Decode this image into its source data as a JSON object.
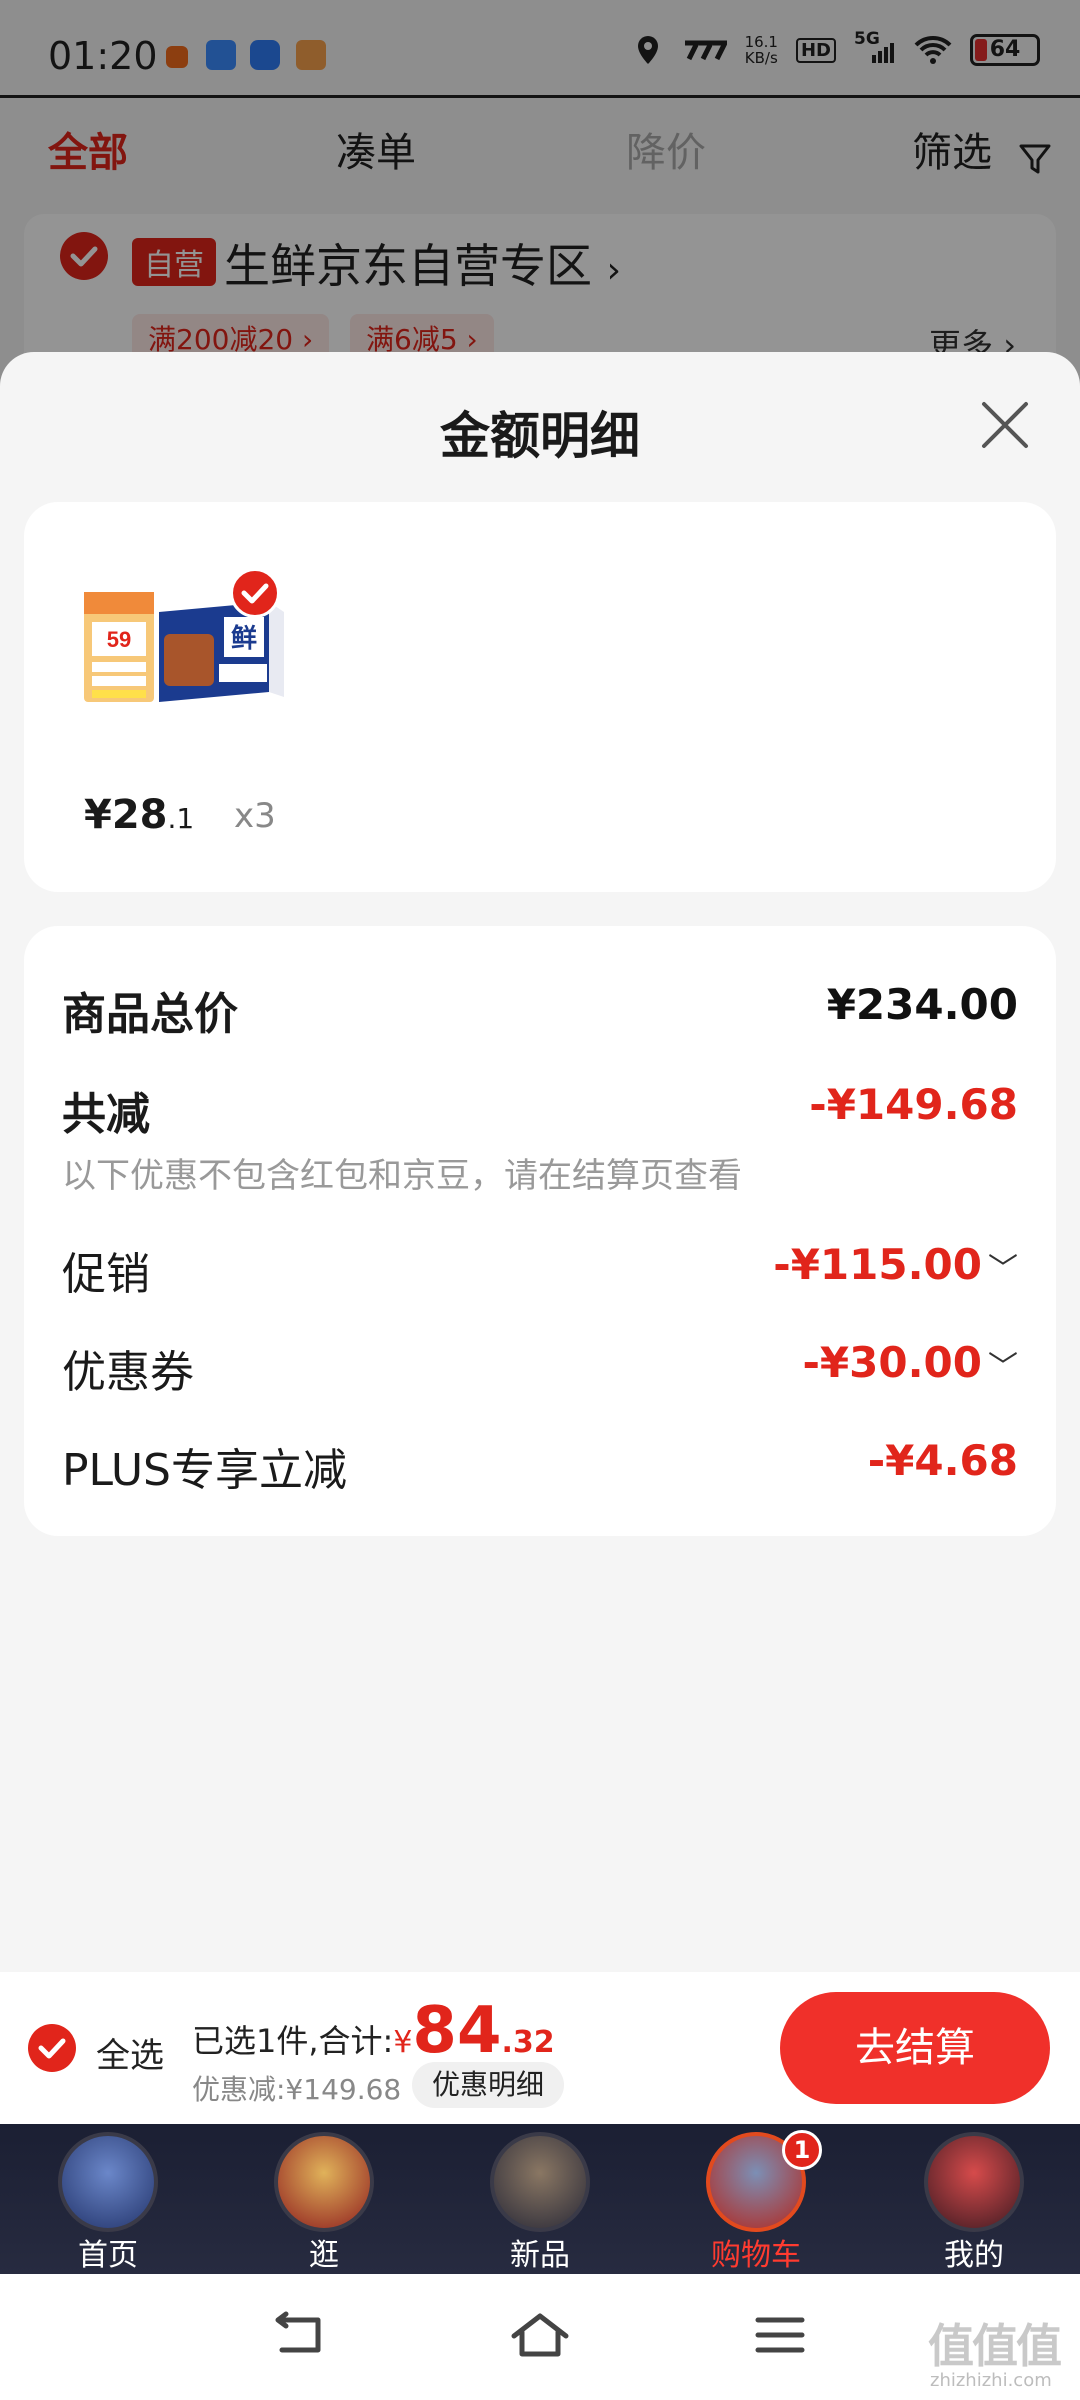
{
  "status": {
    "time": "01:20",
    "speed": "16.1",
    "speed_unit": "KB/s",
    "net": "5G",
    "hd": "HD",
    "battery": "64"
  },
  "top_tabs": [
    "全部",
    "凑单",
    "降价",
    "筛选"
  ],
  "shop": {
    "tag": "自营",
    "name": "生鲜京东自营专区",
    "promos": [
      "满200减20",
      "满6减5"
    ],
    "more": "更多"
  },
  "sheet": {
    "title": "金额明细",
    "item": {
      "price_yen": "¥",
      "price_int": "28",
      "price_dec": ".1",
      "qty": "x3"
    },
    "total_label": "商品总价",
    "total_value": "¥234.00",
    "discount_label": "共减",
    "discount_value": "-¥149.68",
    "discount_note": "以下优惠不包含红包和京豆，请在结算页查看",
    "rows": [
      {
        "label": "促销",
        "value": "-¥115.00"
      },
      {
        "label": "优惠券",
        "value": "-¥30.00"
      },
      {
        "label": "PLUS专享立减",
        "value": "-¥4.68"
      }
    ]
  },
  "checkout": {
    "select_all": "全选",
    "summary_prefix": "已选1件,合计:",
    "amount_yen": "¥",
    "amount_int": "84",
    "amount_dec": ".32",
    "discount_text": "优惠减:¥149.68",
    "detail_button": "优惠明细",
    "pay_button": "去结算"
  },
  "tabbar": {
    "items": [
      "首页",
      "逛",
      "新品",
      "购物车",
      "我的"
    ],
    "cart_badge": "1"
  },
  "watermark": {
    "main": "值值值",
    "sub": "zhizhizhi.com"
  },
  "colors": {
    "accent": "#e1251b",
    "pay_button": "#f0302a"
  }
}
